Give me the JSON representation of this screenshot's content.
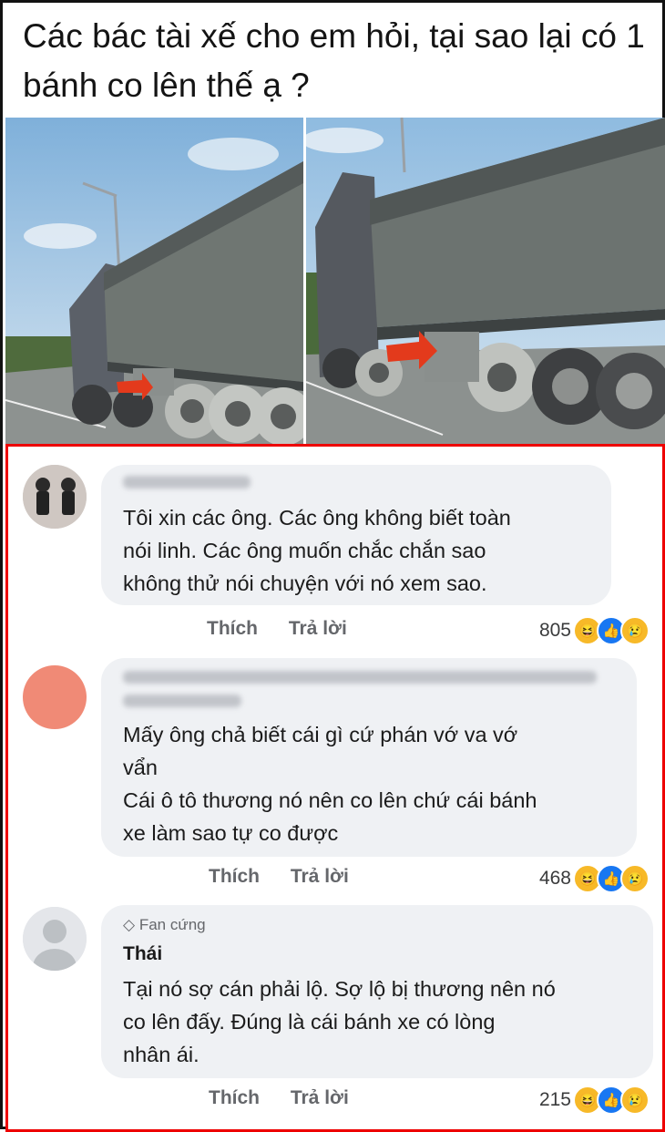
{
  "title": "Các bác tài xế cho em hỏi, tại sao lại có 1 bánh co lên thế ạ ?",
  "comments": [
    {
      "author": "",
      "text": "Tôi xin các ông. Các ông không biết toàn\nnói linh. Các ông muốn chắc chắn sao\nkhông thử nói chuyện với nó xem sao.",
      "like": "Thích",
      "reply": "Trả lời",
      "count": "805"
    },
    {
      "author": "",
      "text": "Mấy ông chả biết cái gì cứ phán vớ va vớ\nvẩn\nCái ô tô thương nó nên co lên chứ cái bánh\nxe làm sao tự co được",
      "like": "Thích",
      "reply": "Trả lời",
      "count": "468"
    },
    {
      "badge": "Fan cứng",
      "author": "Thái",
      "text": "Tại nó sợ cán phải lộ. Sợ lộ bị thương nên nó\nco lên đấy. Đúng là cái bánh xe có lòng\nnhân ái.",
      "like": "Thích",
      "reply": "Trả lời",
      "count": "215"
    }
  ],
  "colors": {
    "comments_border": "#e00000",
    "bubble": "#eff1f4",
    "haha": "#f7b928",
    "like": "#1877f2",
    "sad": "#f7b928"
  },
  "icons": [
    "arrow-icon",
    "diamond-icon",
    "haha-icon",
    "like-icon",
    "sad-icon"
  ]
}
